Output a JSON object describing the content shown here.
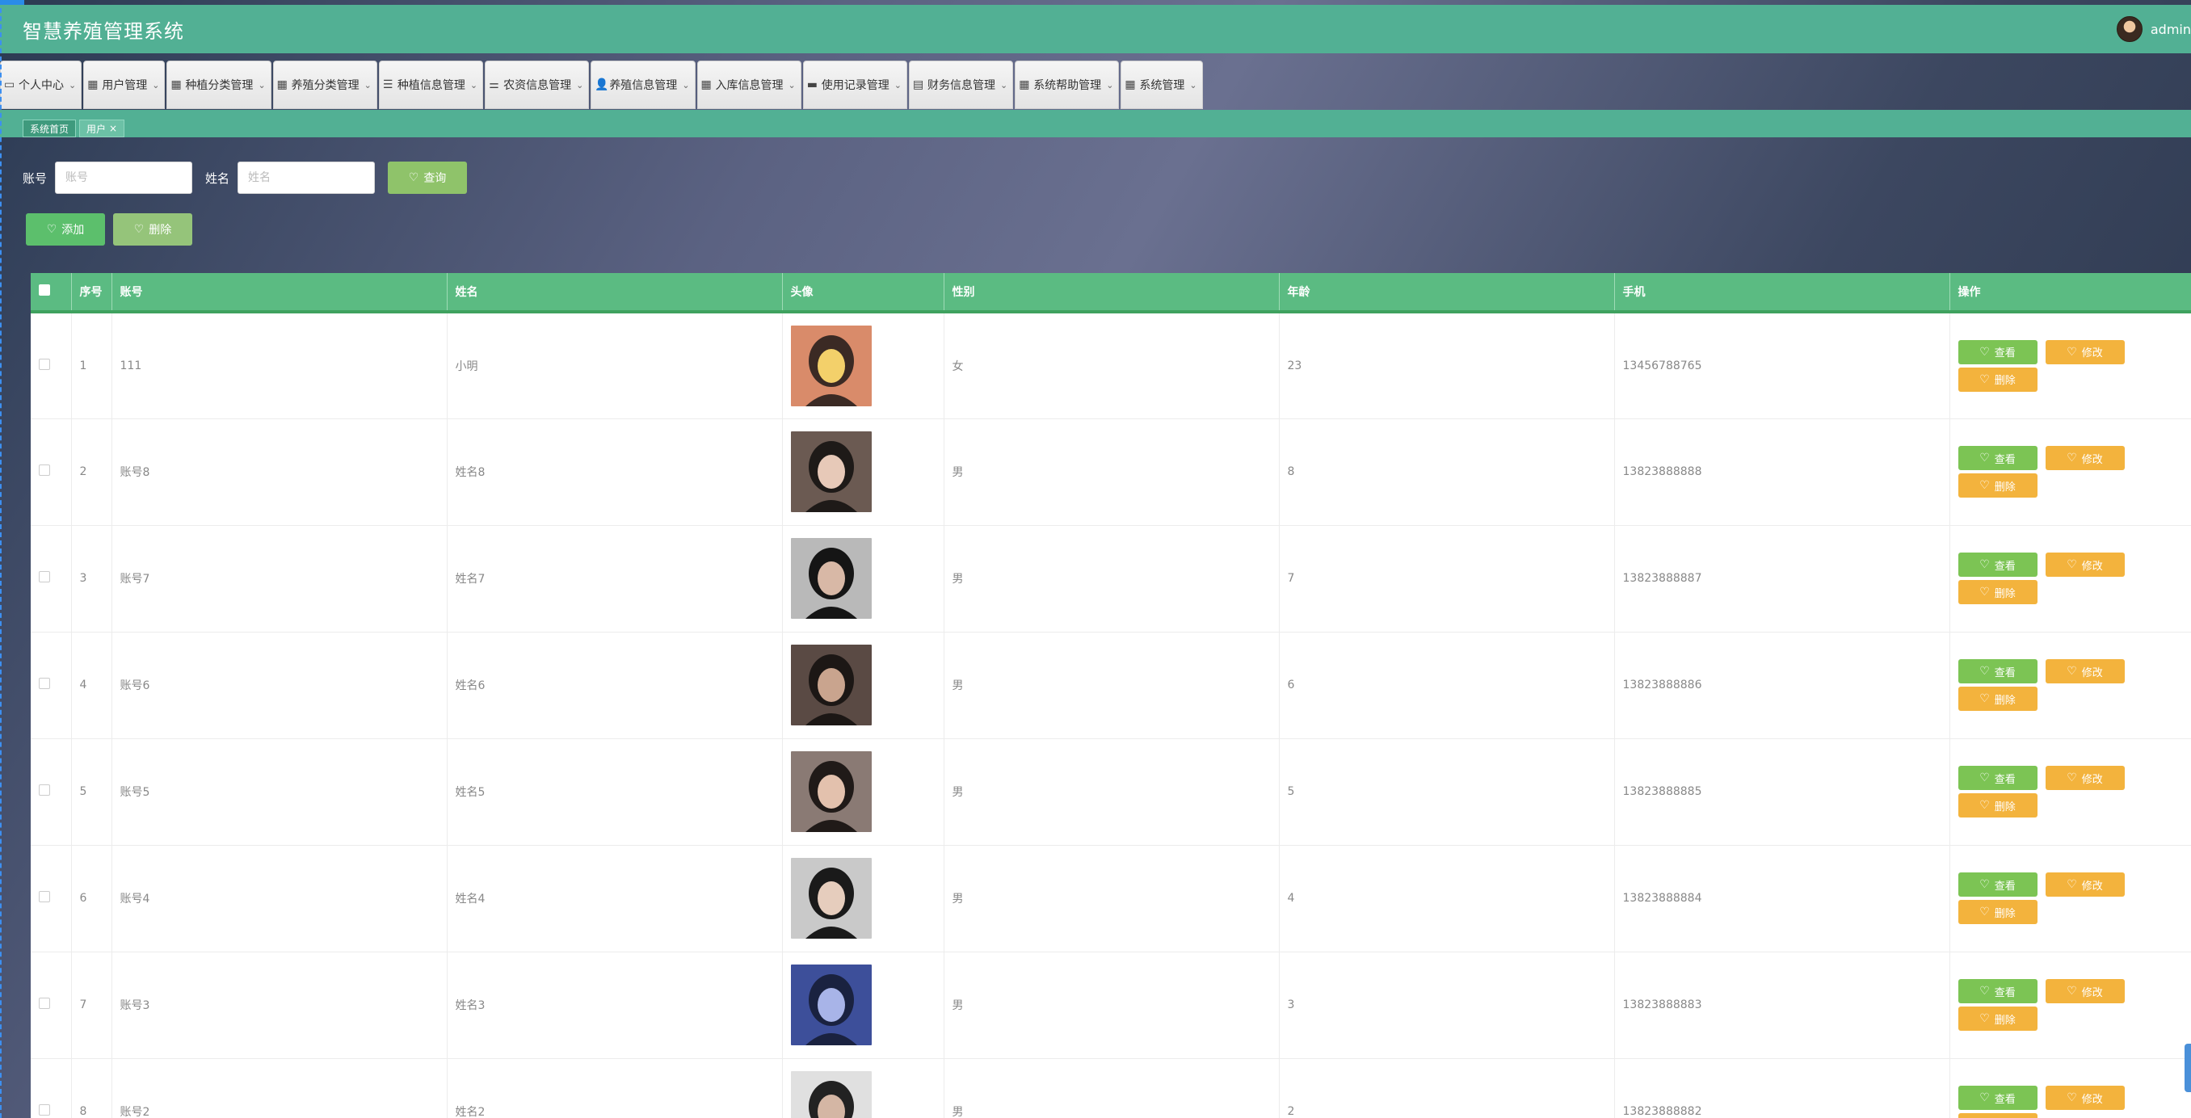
{
  "app": {
    "title": "智慧养殖管理系统",
    "user": "admin"
  },
  "colors": {
    "primary": "#52b094",
    "table_header": "#5bbb82",
    "view_button": "#7cc454",
    "edit_button": "#f3b33d",
    "delete_button": "#f3b33d"
  },
  "menu": [
    {
      "label": "个人中心",
      "icon": "calendar-icon"
    },
    {
      "label": "用户管理",
      "icon": "grid-icon"
    },
    {
      "label": "种植分类管理",
      "icon": "grid-icon"
    },
    {
      "label": "养殖分类管理",
      "icon": "grid-icon"
    },
    {
      "label": "种植信息管理",
      "icon": "list-icon"
    },
    {
      "label": "农资信息管理",
      "icon": "sliders-icon"
    },
    {
      "label": "养殖信息管理",
      "icon": "person-icon"
    },
    {
      "label": "入库信息管理",
      "icon": "grid-icon"
    },
    {
      "label": "使用记录管理",
      "icon": "chat-icon"
    },
    {
      "label": "财务信息管理",
      "icon": "clipboard-icon"
    },
    {
      "label": "系统帮助管理",
      "icon": "grid-icon"
    },
    {
      "label": "系统管理",
      "icon": "grid-icon"
    }
  ],
  "tabs": [
    {
      "label": "系统首页"
    },
    {
      "label": "用户",
      "close": "×"
    }
  ],
  "search": {
    "account_label": "账号",
    "account_placeholder": "账号",
    "name_label": "姓名",
    "name_placeholder": "姓名",
    "search_button": "查询"
  },
  "actions": {
    "add_button": "添加",
    "delete_button": "删除"
  },
  "table": {
    "headers": [
      "序号",
      "账号",
      "姓名",
      "头像",
      "性别",
      "年龄",
      "手机",
      "操作"
    ],
    "row_actions": {
      "view": "查看",
      "edit": "修改",
      "delete": "删除"
    },
    "rows": [
      {
        "index": "1",
        "account": "111",
        "name": "小明",
        "gender": "女",
        "age": "23",
        "phone": "13456788765"
      },
      {
        "index": "2",
        "account": "账号8",
        "name": "姓名8",
        "gender": "男",
        "age": "8",
        "phone": "13823888888"
      },
      {
        "index": "3",
        "account": "账号7",
        "name": "姓名7",
        "gender": "男",
        "age": "7",
        "phone": "13823888887"
      },
      {
        "index": "4",
        "account": "账号6",
        "name": "姓名6",
        "gender": "男",
        "age": "6",
        "phone": "13823888886"
      },
      {
        "index": "5",
        "account": "账号5",
        "name": "姓名5",
        "gender": "男",
        "age": "5",
        "phone": "13823888885"
      },
      {
        "index": "6",
        "account": "账号4",
        "name": "姓名4",
        "gender": "男",
        "age": "4",
        "phone": "13823888884"
      },
      {
        "index": "7",
        "account": "账号3",
        "name": "姓名3",
        "gender": "男",
        "age": "3",
        "phone": "13823888883"
      },
      {
        "index": "8",
        "account": "账号2",
        "name": "姓名2",
        "gender": "男",
        "age": "2",
        "phone": "13823888882"
      }
    ]
  }
}
